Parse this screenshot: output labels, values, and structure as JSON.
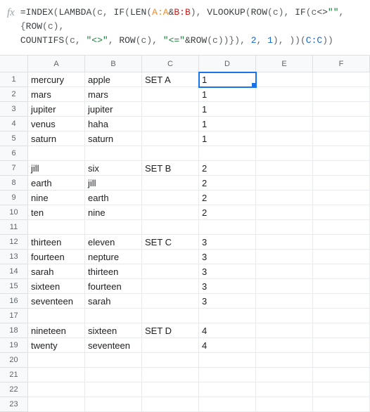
{
  "formula_bar": {
    "fx_label": "fx",
    "tokens": [
      {
        "t": "=",
        "c": "tok-op"
      },
      {
        "t": "INDEX",
        "c": "tok-fn"
      },
      {
        "t": "(",
        "c": "tok-punct"
      },
      {
        "t": "LAMBDA",
        "c": "tok-fn"
      },
      {
        "t": "(",
        "c": "tok-punct"
      },
      {
        "t": "c",
        "c": "tok-var"
      },
      {
        "t": ", ",
        "c": "tok-punct"
      },
      {
        "t": "IF",
        "c": "tok-fn"
      },
      {
        "t": "(",
        "c": "tok-punct"
      },
      {
        "t": "LEN",
        "c": "tok-fn"
      },
      {
        "t": "(",
        "c": "tok-punct"
      },
      {
        "t": "A:A",
        "c": "tok-ref1"
      },
      {
        "t": "&",
        "c": "tok-op"
      },
      {
        "t": "B:B",
        "c": "tok-ref2"
      },
      {
        "t": ")",
        "c": "tok-punct"
      },
      {
        "t": ", ",
        "c": "tok-punct"
      },
      {
        "t": "VLOOKUP",
        "c": "tok-fn"
      },
      {
        "t": "(",
        "c": "tok-punct"
      },
      {
        "t": "ROW",
        "c": "tok-fn"
      },
      {
        "t": "(",
        "c": "tok-punct"
      },
      {
        "t": "c",
        "c": "tok-var"
      },
      {
        "t": ")",
        "c": "tok-punct"
      },
      {
        "t": ", ",
        "c": "tok-punct"
      },
      {
        "t": "IF",
        "c": "tok-fn"
      },
      {
        "t": "(",
        "c": "tok-punct"
      },
      {
        "t": "c",
        "c": "tok-var"
      },
      {
        "t": "<>",
        "c": "tok-op"
      },
      {
        "t": "\"\"",
        "c": "tok-str"
      },
      {
        "t": ", ",
        "c": "tok-punct"
      },
      {
        "t": "{",
        "c": "tok-punct"
      },
      {
        "t": "ROW",
        "c": "tok-fn"
      },
      {
        "t": "(",
        "c": "tok-punct"
      },
      {
        "t": "c",
        "c": "tok-var"
      },
      {
        "t": ")",
        "c": "tok-punct"
      },
      {
        "t": ",",
        "c": "tok-punct"
      },
      {
        "t": "\n",
        "c": ""
      },
      {
        "t": "COUNTIFS",
        "c": "tok-fn"
      },
      {
        "t": "(",
        "c": "tok-punct"
      },
      {
        "t": "c",
        "c": "tok-var"
      },
      {
        "t": ", ",
        "c": "tok-punct"
      },
      {
        "t": "\"<>\"",
        "c": "tok-str"
      },
      {
        "t": ", ",
        "c": "tok-punct"
      },
      {
        "t": "ROW",
        "c": "tok-fn"
      },
      {
        "t": "(",
        "c": "tok-punct"
      },
      {
        "t": "c",
        "c": "tok-var"
      },
      {
        "t": ")",
        "c": "tok-punct"
      },
      {
        "t": ", ",
        "c": "tok-punct"
      },
      {
        "t": "\"<=\"",
        "c": "tok-str"
      },
      {
        "t": "&",
        "c": "tok-op"
      },
      {
        "t": "ROW",
        "c": "tok-fn"
      },
      {
        "t": "(",
        "c": "tok-punct"
      },
      {
        "t": "c",
        "c": "tok-var"
      },
      {
        "t": ")",
        "c": "tok-punct"
      },
      {
        "t": ")",
        "c": "tok-punct"
      },
      {
        "t": "}",
        "c": "tok-punct"
      },
      {
        "t": ")",
        "c": "tok-punct"
      },
      {
        "t": ", ",
        "c": "tok-punct"
      },
      {
        "t": "2",
        "c": "tok-num"
      },
      {
        "t": ", ",
        "c": "tok-punct"
      },
      {
        "t": "1",
        "c": "tok-num"
      },
      {
        "t": ")",
        "c": "tok-punct"
      },
      {
        "t": ", ",
        "c": "tok-punct"
      },
      {
        "t": ")",
        "c": "tok-punct"
      },
      {
        "t": ")",
        "c": "tok-punct"
      },
      {
        "t": "(",
        "c": "tok-punct"
      },
      {
        "t": "C:C",
        "c": "tok-ref3"
      },
      {
        "t": ")",
        "c": "tok-punct"
      },
      {
        "t": ")",
        "c": "tok-punct"
      }
    ]
  },
  "columns": [
    "A",
    "B",
    "C",
    "D",
    "E",
    "F"
  ],
  "row_count": 23,
  "selected": {
    "row": 1,
    "col": "D"
  },
  "cells": {
    "1": {
      "A": "mercury",
      "B": "apple",
      "C": "SET A",
      "D": "1"
    },
    "2": {
      "A": "mars",
      "B": "mars",
      "D": "1"
    },
    "3": {
      "A": "jupiter",
      "B": "jupiter",
      "D": "1"
    },
    "4": {
      "A": "venus",
      "B": "haha",
      "D": "1"
    },
    "5": {
      "A": "saturn",
      "B": "saturn",
      "D": "1"
    },
    "6": {},
    "7": {
      "A": "jill",
      "B": "six",
      "C": "SET B",
      "D": "2"
    },
    "8": {
      "A": "earth",
      "B": "jill",
      "D": "2"
    },
    "9": {
      "A": "nine",
      "B": "earth",
      "D": "2"
    },
    "10": {
      "A": "ten",
      "B": "nine",
      "D": "2"
    },
    "11": {},
    "12": {
      "A": "thirteen",
      "B": "eleven",
      "C": "SET C",
      "D": "3"
    },
    "13": {
      "A": "fourteen",
      "B": "nepture",
      "D": "3"
    },
    "14": {
      "A": "sarah",
      "B": "thirteen",
      "D": "3"
    },
    "15": {
      "A": "sixteen",
      "B": "fourteen",
      "D": "3"
    },
    "16": {
      "A": "seventeen",
      "B": "sarah",
      "D": "3"
    },
    "17": {},
    "18": {
      "A": "nineteen",
      "B": "sixteen",
      "C": "SET D",
      "D": "4"
    },
    "19": {
      "A": "twenty",
      "B": "seventeen",
      "D": "4"
    },
    "20": {},
    "21": {},
    "22": {},
    "23": {}
  }
}
